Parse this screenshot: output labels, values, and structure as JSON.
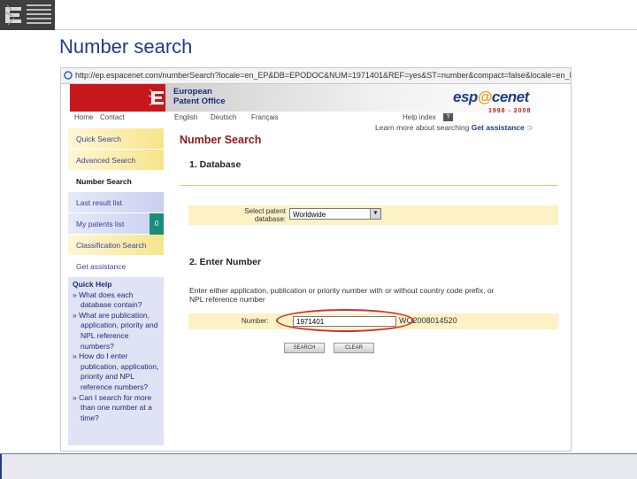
{
  "slide": {
    "title": "Number search"
  },
  "browser": {
    "url": "http://ep.espacenet.com/numberSearch?locale=en_EP&DB=EPODOC&NUM=1971401&REF=yes&ST=number&compact=false&locale=en_EP"
  },
  "banner": {
    "org_line1": "European",
    "org_line2": "Patent Office",
    "brand_pre": "esp",
    "brand_at": "@",
    "brand_post": "cenet",
    "years": "1998 - 2008"
  },
  "nav": {
    "home": "Home",
    "contact": "Contact",
    "english": "English",
    "deutsch": "Deutsch",
    "francais": "Français",
    "help_index": "Help index",
    "help_q": "?",
    "learn_text": "Learn more about searching",
    "learn_bold": "Get assistance"
  },
  "sidebar": {
    "items": [
      {
        "label": "Quick Search"
      },
      {
        "label": "Advanced Search"
      },
      {
        "label": "Number Search"
      },
      {
        "label": "Last result list"
      },
      {
        "label": "My patents list",
        "count": "0"
      },
      {
        "label": "Classification Search"
      },
      {
        "label": "Get assistance"
      }
    ]
  },
  "quickhelp": {
    "title": "Quick Help",
    "q1": "» What does each database contain?",
    "q2": "» What are publication, application, priority and NPL reference numbers?",
    "q3": "» How do I enter publication, application, priority and NPL reference numbers?",
    "q4": "» Can I search for more than one number at a time?"
  },
  "main": {
    "title": "Number Search",
    "section1": "1. Database",
    "db_label": "Select patent database:",
    "db_value": "Worldwide",
    "section2": "2. Enter Number",
    "instructions": "Enter either application, publication or priority number with or without country code prefix, or NPL reference number",
    "number_label": "Number:",
    "number_value": "1971401",
    "number_example": "WO2008014520",
    "search_btn": "SEARCH",
    "clear_btn": "CLEAR"
  },
  "colors": {
    "slide_title": "#233a86",
    "banner_red": "#c8161d",
    "main_title": "#8b1a1a",
    "highlight_circle": "#d23030"
  }
}
